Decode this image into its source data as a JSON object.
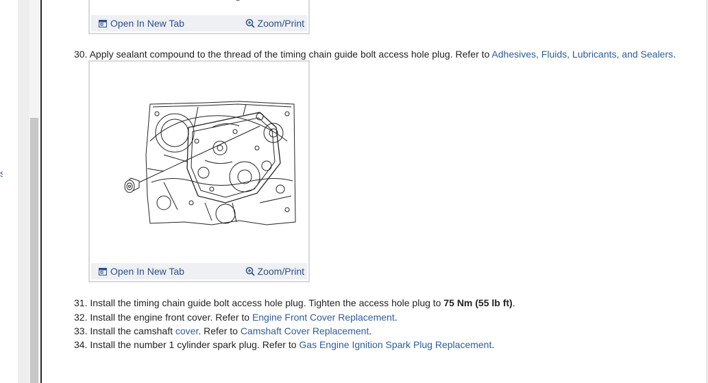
{
  "figure_actions": {
    "open_new_tab": "Open In New Tab",
    "zoom_print": "Zoom/Print"
  },
  "steps": [
    {
      "num": "30.",
      "text_before": "Apply sealant compound to the thread of the timing chain guide bolt access hole plug. Refer to ",
      "link": "Adhesives, Fluids, Lubricants, and Sealers",
      "text_after": "."
    },
    {
      "num": "31.",
      "text_before": "Install the timing chain guide bolt access hole plug. Tighten the access hole plug to ",
      "bold": "75 Nm (55 lb ft)",
      "text_after": "."
    },
    {
      "num": "32.",
      "text_before": "Install the engine front cover. Refer to ",
      "link": "Engine Front Cover Replacement",
      "text_after": "."
    },
    {
      "num": "33.",
      "text_before": "Install the camshaft ",
      "link_a": "cover",
      "text_mid": ". Refer to ",
      "link": "Camshaft Cover Replacement",
      "text_after": "."
    },
    {
      "num": "34.",
      "text_before": "Install the number 1 cylinder spark plug. Refer to ",
      "link": "Gas Engine Ignition Spark Plug Replacement",
      "text_after": "."
    }
  ],
  "colors": {
    "link": "#2d5d9a",
    "toolbar_bg": "#eef0f3",
    "figure_border": "#d6d9de"
  }
}
